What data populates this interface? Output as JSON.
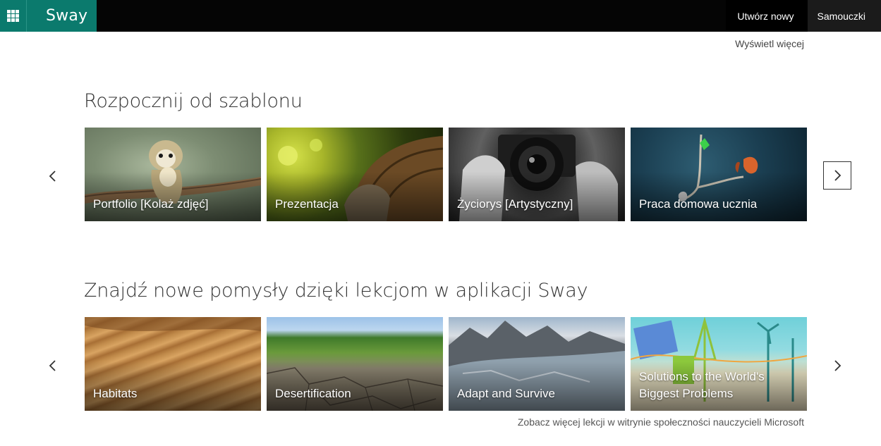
{
  "topbar": {
    "app_name": "Sway",
    "app_launcher_icon": "waffle-grid-icon",
    "create_new_label": "Utwórz nowy",
    "tutorials_label": "Samouczki"
  },
  "view_more_label": "Wyświetl więcej",
  "templates": {
    "title": "Rozpocznij od szablonu",
    "items": [
      {
        "label": "Portfolio [Kolaż zdjęć]"
      },
      {
        "label": "Prezentacja"
      },
      {
        "label": "Życiorys [Artystyczny]"
      },
      {
        "label": "Praca domowa ucznia"
      }
    ]
  },
  "lessons": {
    "title": "Znajdź nowe pomysły dzięki lekcjom w aplikacji Sway",
    "items": [
      {
        "label": "Habitats"
      },
      {
        "label": "Desertification"
      },
      {
        "label": "Adapt and Survive"
      },
      {
        "label": "Solutions to the World's Biggest Problems"
      }
    ],
    "more_link": "Zobacz więcej lekcji w witrynie społeczności nauczycieli Microsoft"
  },
  "colors": {
    "brand_teal": "#0b7a6d",
    "topbar_bg": "#050505"
  }
}
